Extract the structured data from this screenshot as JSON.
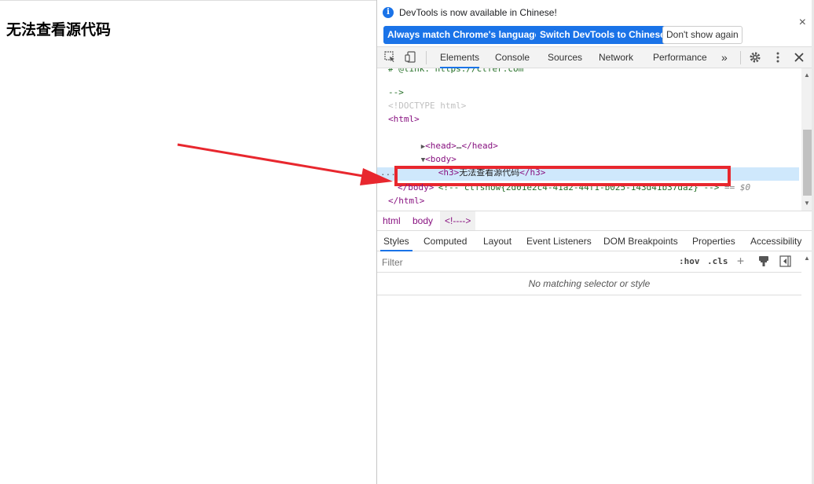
{
  "page": {
    "heading": "无法查看源代码"
  },
  "infobar": {
    "message": "DevTools is now available in Chinese!",
    "btn_match": "Always match Chrome's language",
    "btn_switch": "Switch DevTools to Chinese",
    "btn_dont_show": "Don't show again",
    "close": "×"
  },
  "toolbar": {
    "tabs": [
      "Elements",
      "Console",
      "Sources",
      "Network",
      "Performance"
    ],
    "more": "»"
  },
  "elements": {
    "line0": "# @link: https://ctfer.com",
    "line1": "-->",
    "line2": "<!DOCTYPE html>",
    "line3_tag": "<html>",
    "line4_a": "<head>",
    "line4_b": "…",
    "line4_c": "</head>",
    "line5": "<body>",
    "line6_open": "<h3>",
    "line6_text": "无法查看源代码",
    "line6_close": "</h3>",
    "line7_comment": "<!-- ctfshow{2d01e2c4-41a2-44f1-b025-143d41b37da2} -->",
    "line7_suffix": " == $0",
    "line8": "</body>",
    "line9": "</html>",
    "dots": "..."
  },
  "breadcrumb": [
    "html",
    "body",
    "<!---->"
  ],
  "subtabs": [
    "Styles",
    "Computed",
    "Layout",
    "Event Listeners",
    "DOM Breakpoints",
    "Properties",
    "Accessibility"
  ],
  "styles": {
    "filter_placeholder": "Filter",
    "hov": ":hov",
    "cls": ".cls",
    "plus": "+",
    "no_match": "No matching selector or style"
  },
  "colors": {
    "accent": "#1a73e8",
    "highlight_box": "#e8272e",
    "arrow": "#e8272e"
  }
}
